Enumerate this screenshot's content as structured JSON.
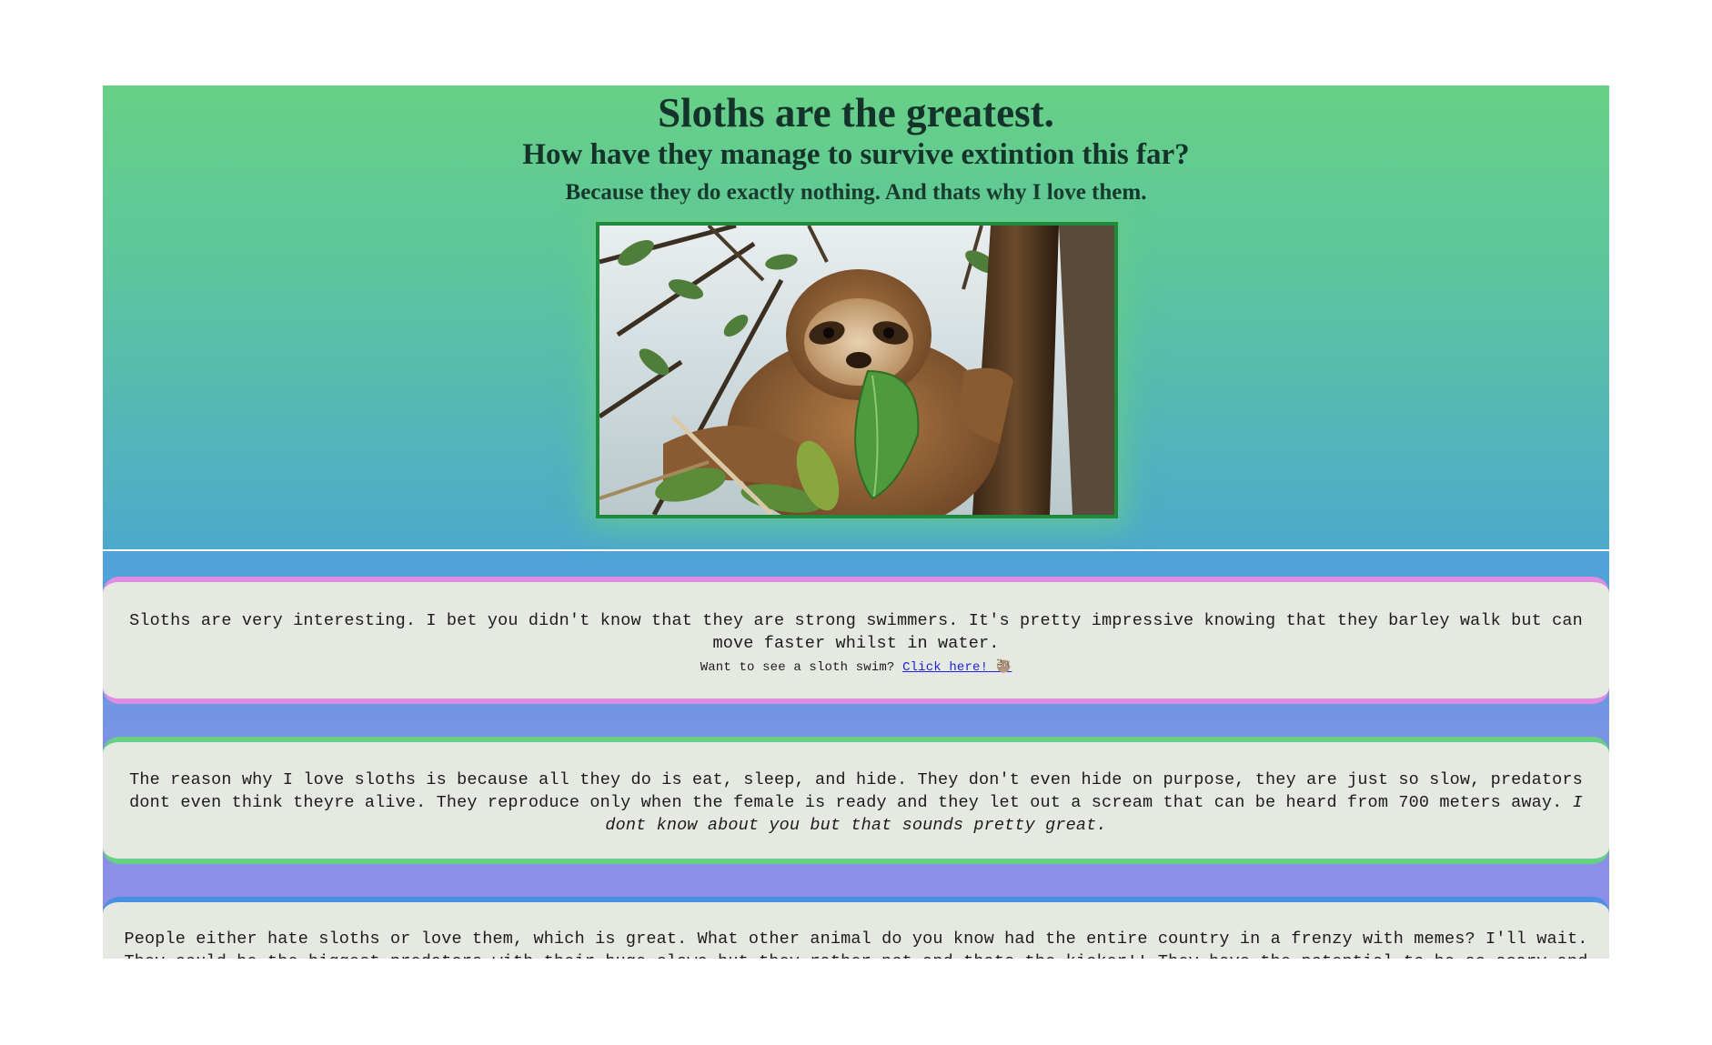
{
  "header": {
    "title": "Sloths are the greatest.",
    "subtitle": "How have they manage to survive extintion this far?",
    "tagline": "Because they do exactly nothing. And thats why I love them."
  },
  "image": {
    "alt": "sloth holding a leaf in a tree",
    "border_color": "#1f8a3c"
  },
  "sections": [
    {
      "text": "Sloths are very interesting. I bet you didn't know that they are strong swimmers. It's pretty impressive knowing that they barley walk but can move faster whilst in water.",
      "prompt": "Want to see a sloth swim?",
      "link_label": "Click here!",
      "link_icon": "sloth-emoji-icon",
      "border_color": "#df8de0"
    },
    {
      "text": "The reason why I love sloths is because all they do is eat, sleep, and hide. They don't even hide on purpose, they are just so slow, predators dont even think theyre alive. They reproduce only when the female is ready and they let out a scream that can be heard from 700 meters away.",
      "emphasis": "I dont know about you but that sounds pretty great.",
      "border_color": "#67d086"
    },
    {
      "text": "People either hate sloths or love them, which is great. What other animal do you know had the entire country in a frenzy with memes? I'll wait. They could be the biggest predators with their huge claws but they rather not and thats the kicker!! They have the potential to be so scary and choose to",
      "border_color": "#4a90e2"
    }
  ],
  "colors": {
    "gradient_top": "#67d086",
    "gradient_bottom": "#8b8fe8",
    "card_background": "#e5e9e1"
  }
}
